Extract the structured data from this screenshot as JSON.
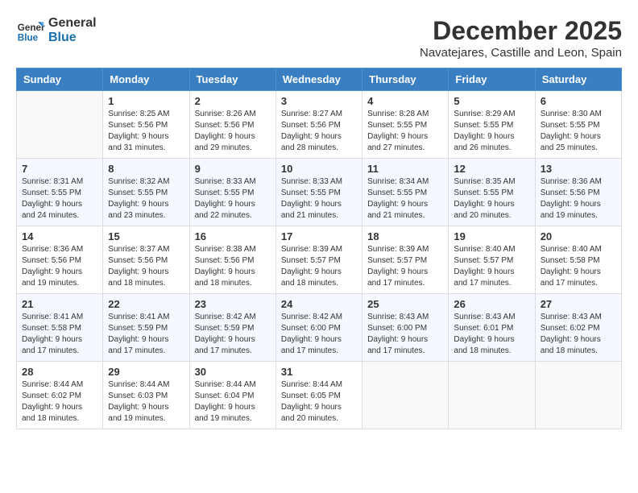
{
  "header": {
    "logo_line1": "General",
    "logo_line2": "Blue",
    "month_year": "December 2025",
    "location": "Navatejares, Castille and Leon, Spain"
  },
  "days_of_week": [
    "Sunday",
    "Monday",
    "Tuesday",
    "Wednesday",
    "Thursday",
    "Friday",
    "Saturday"
  ],
  "weeks": [
    [
      {
        "day": "",
        "sunrise": "",
        "sunset": "",
        "daylight": ""
      },
      {
        "day": "1",
        "sunrise": "Sunrise: 8:25 AM",
        "sunset": "Sunset: 5:56 PM",
        "daylight": "Daylight: 9 hours and 31 minutes."
      },
      {
        "day": "2",
        "sunrise": "Sunrise: 8:26 AM",
        "sunset": "Sunset: 5:56 PM",
        "daylight": "Daylight: 9 hours and 29 minutes."
      },
      {
        "day": "3",
        "sunrise": "Sunrise: 8:27 AM",
        "sunset": "Sunset: 5:56 PM",
        "daylight": "Daylight: 9 hours and 28 minutes."
      },
      {
        "day": "4",
        "sunrise": "Sunrise: 8:28 AM",
        "sunset": "Sunset: 5:55 PM",
        "daylight": "Daylight: 9 hours and 27 minutes."
      },
      {
        "day": "5",
        "sunrise": "Sunrise: 8:29 AM",
        "sunset": "Sunset: 5:55 PM",
        "daylight": "Daylight: 9 hours and 26 minutes."
      },
      {
        "day": "6",
        "sunrise": "Sunrise: 8:30 AM",
        "sunset": "Sunset: 5:55 PM",
        "daylight": "Daylight: 9 hours and 25 minutes."
      }
    ],
    [
      {
        "day": "7",
        "sunrise": "Sunrise: 8:31 AM",
        "sunset": "Sunset: 5:55 PM",
        "daylight": "Daylight: 9 hours and 24 minutes."
      },
      {
        "day": "8",
        "sunrise": "Sunrise: 8:32 AM",
        "sunset": "Sunset: 5:55 PM",
        "daylight": "Daylight: 9 hours and 23 minutes."
      },
      {
        "day": "9",
        "sunrise": "Sunrise: 8:33 AM",
        "sunset": "Sunset: 5:55 PM",
        "daylight": "Daylight: 9 hours and 22 minutes."
      },
      {
        "day": "10",
        "sunrise": "Sunrise: 8:33 AM",
        "sunset": "Sunset: 5:55 PM",
        "daylight": "Daylight: 9 hours and 21 minutes."
      },
      {
        "day": "11",
        "sunrise": "Sunrise: 8:34 AM",
        "sunset": "Sunset: 5:55 PM",
        "daylight": "Daylight: 9 hours and 21 minutes."
      },
      {
        "day": "12",
        "sunrise": "Sunrise: 8:35 AM",
        "sunset": "Sunset: 5:55 PM",
        "daylight": "Daylight: 9 hours and 20 minutes."
      },
      {
        "day": "13",
        "sunrise": "Sunrise: 8:36 AM",
        "sunset": "Sunset: 5:56 PM",
        "daylight": "Daylight: 9 hours and 19 minutes."
      }
    ],
    [
      {
        "day": "14",
        "sunrise": "Sunrise: 8:36 AM",
        "sunset": "Sunset: 5:56 PM",
        "daylight": "Daylight: 9 hours and 19 minutes."
      },
      {
        "day": "15",
        "sunrise": "Sunrise: 8:37 AM",
        "sunset": "Sunset: 5:56 PM",
        "daylight": "Daylight: 9 hours and 18 minutes."
      },
      {
        "day": "16",
        "sunrise": "Sunrise: 8:38 AM",
        "sunset": "Sunset: 5:56 PM",
        "daylight": "Daylight: 9 hours and 18 minutes."
      },
      {
        "day": "17",
        "sunrise": "Sunrise: 8:39 AM",
        "sunset": "Sunset: 5:57 PM",
        "daylight": "Daylight: 9 hours and 18 minutes."
      },
      {
        "day": "18",
        "sunrise": "Sunrise: 8:39 AM",
        "sunset": "Sunset: 5:57 PM",
        "daylight": "Daylight: 9 hours and 17 minutes."
      },
      {
        "day": "19",
        "sunrise": "Sunrise: 8:40 AM",
        "sunset": "Sunset: 5:57 PM",
        "daylight": "Daylight: 9 hours and 17 minutes."
      },
      {
        "day": "20",
        "sunrise": "Sunrise: 8:40 AM",
        "sunset": "Sunset: 5:58 PM",
        "daylight": "Daylight: 9 hours and 17 minutes."
      }
    ],
    [
      {
        "day": "21",
        "sunrise": "Sunrise: 8:41 AM",
        "sunset": "Sunset: 5:58 PM",
        "daylight": "Daylight: 9 hours and 17 minutes."
      },
      {
        "day": "22",
        "sunrise": "Sunrise: 8:41 AM",
        "sunset": "Sunset: 5:59 PM",
        "daylight": "Daylight: 9 hours and 17 minutes."
      },
      {
        "day": "23",
        "sunrise": "Sunrise: 8:42 AM",
        "sunset": "Sunset: 5:59 PM",
        "daylight": "Daylight: 9 hours and 17 minutes."
      },
      {
        "day": "24",
        "sunrise": "Sunrise: 8:42 AM",
        "sunset": "Sunset: 6:00 PM",
        "daylight": "Daylight: 9 hours and 17 minutes."
      },
      {
        "day": "25",
        "sunrise": "Sunrise: 8:43 AM",
        "sunset": "Sunset: 6:00 PM",
        "daylight": "Daylight: 9 hours and 17 minutes."
      },
      {
        "day": "26",
        "sunrise": "Sunrise: 8:43 AM",
        "sunset": "Sunset: 6:01 PM",
        "daylight": "Daylight: 9 hours and 18 minutes."
      },
      {
        "day": "27",
        "sunrise": "Sunrise: 8:43 AM",
        "sunset": "Sunset: 6:02 PM",
        "daylight": "Daylight: 9 hours and 18 minutes."
      }
    ],
    [
      {
        "day": "28",
        "sunrise": "Sunrise: 8:44 AM",
        "sunset": "Sunset: 6:02 PM",
        "daylight": "Daylight: 9 hours and 18 minutes."
      },
      {
        "day": "29",
        "sunrise": "Sunrise: 8:44 AM",
        "sunset": "Sunset: 6:03 PM",
        "daylight": "Daylight: 9 hours and 19 minutes."
      },
      {
        "day": "30",
        "sunrise": "Sunrise: 8:44 AM",
        "sunset": "Sunset: 6:04 PM",
        "daylight": "Daylight: 9 hours and 19 minutes."
      },
      {
        "day": "31",
        "sunrise": "Sunrise: 8:44 AM",
        "sunset": "Sunset: 6:05 PM",
        "daylight": "Daylight: 9 hours and 20 minutes."
      },
      {
        "day": "",
        "sunrise": "",
        "sunset": "",
        "daylight": ""
      },
      {
        "day": "",
        "sunrise": "",
        "sunset": "",
        "daylight": ""
      },
      {
        "day": "",
        "sunrise": "",
        "sunset": "",
        "daylight": ""
      }
    ]
  ]
}
